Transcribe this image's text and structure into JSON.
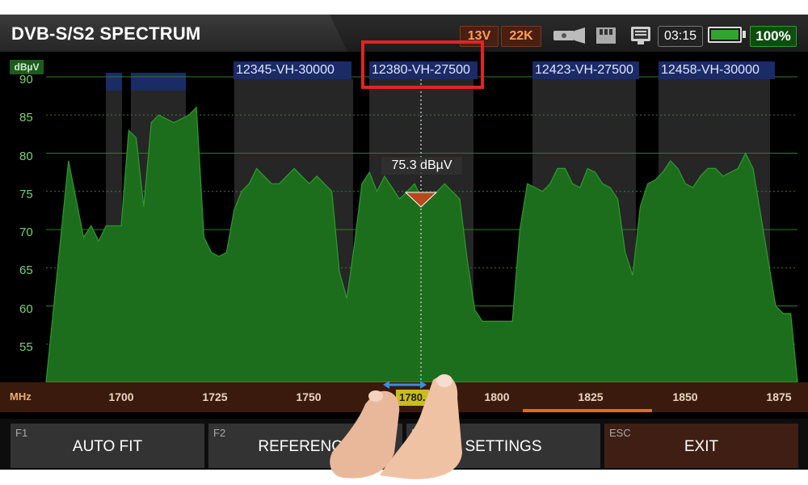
{
  "header": {
    "title": "DVB-S/S2 SPECTRUM",
    "lnb_voltage": "13V",
    "lnb_tone": "22K",
    "time": "03:15",
    "battery_percent": "100%",
    "battery_level": 1.0,
    "icons": [
      "flashlight-icon",
      "sd-card-icon",
      "monitor-icon",
      "battery-icon"
    ]
  },
  "plot": {
    "unit": "dBµV",
    "y_ticks": [
      "90",
      "85",
      "80",
      "75",
      "70",
      "65",
      "60",
      "55"
    ],
    "transponders": [
      {
        "label": "12345-VH-30000"
      },
      {
        "label": "12380-VH-27500"
      },
      {
        "label": "12423-VH-27500"
      },
      {
        "label": "12458-VH-30000"
      }
    ],
    "marker_readout": "75.3 dBµV",
    "marker_level_dbuv": 75.3
  },
  "freq_axis": {
    "unit": "MHz",
    "ticks": [
      "1700",
      "1725",
      "1750",
      "1800",
      "1825",
      "1850",
      "1875"
    ],
    "cursor_freq": "1780."
  },
  "softkeys": [
    {
      "key": "F1",
      "label": "AUTO FIT"
    },
    {
      "key": "F2",
      "label": "REFERENCE"
    },
    {
      "key": "F3",
      "label": "SETTINGS"
    },
    {
      "key": "ESC",
      "label": "EXIT"
    }
  ],
  "colors": {
    "spectrum_fill": "#1c6e1c",
    "spectrum_line": "#2f9a2f",
    "accent_orange": "#e46a1a",
    "highlight_red": "#e02424",
    "transponder_label_bg": "#1b2b66"
  },
  "chart_data": {
    "type": "area",
    "xlabel": "MHz",
    "ylabel": "dBµV",
    "xlim": [
      1686,
      1878
    ],
    "ylim": [
      50,
      90
    ],
    "x": [
      1686,
      1688,
      1690,
      1692,
      1694,
      1696,
      1698,
      1700,
      1702,
      1704,
      1706,
      1708,
      1710,
      1712,
      1714,
      1716,
      1718,
      1720,
      1722,
      1724,
      1726,
      1728,
      1730,
      1732,
      1734,
      1736,
      1738,
      1740,
      1742,
      1744,
      1746,
      1748,
      1750,
      1752,
      1754,
      1756,
      1758,
      1760,
      1762,
      1764,
      1766,
      1768,
      1770,
      1772,
      1774,
      1776,
      1778,
      1780,
      1782,
      1784,
      1786,
      1788,
      1790,
      1792,
      1794,
      1796,
      1798,
      1800,
      1802,
      1804,
      1806,
      1808,
      1810,
      1812,
      1814,
      1816,
      1818,
      1820,
      1822,
      1824,
      1826,
      1828,
      1830,
      1832,
      1834,
      1836,
      1838,
      1840,
      1842,
      1844,
      1846,
      1848,
      1850,
      1852,
      1854,
      1856,
      1858,
      1860,
      1862,
      1864,
      1866,
      1868,
      1870,
      1872,
      1874,
      1876,
      1878
    ],
    "y": [
      79,
      74,
      69,
      70.5,
      68.5,
      70.5,
      70.5,
      70.5,
      83,
      82,
      73,
      84,
      85,
      84.5,
      84,
      84.5,
      85,
      86,
      69,
      67,
      66.5,
      67,
      72.5,
      75,
      76,
      78,
      77,
      76,
      76,
      77,
      78,
      77,
      76,
      77,
      76,
      75,
      64.5,
      61,
      68,
      76,
      77.5,
      75,
      77,
      75.5,
      74,
      75,
      76,
      74,
      74,
      75,
      76,
      75,
      74,
      66,
      59.5,
      58,
      58,
      58,
      58,
      58,
      70,
      76,
      75.5,
      75,
      76,
      78,
      78,
      76,
      75.5,
      78,
      77.5,
      76,
      75.5,
      74,
      67,
      64,
      73,
      76,
      76.5,
      77.5,
      79,
      78,
      76,
      75.5,
      77,
      78,
      78,
      77,
      77.5,
      78,
      80,
      78,
      72,
      66,
      60,
      59,
      59
    ]
  }
}
